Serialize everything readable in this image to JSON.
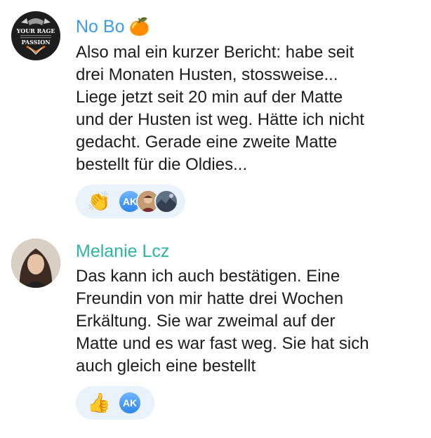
{
  "messages": [
    {
      "author": "No Bo",
      "author_color": "#3d9be9",
      "author_emoji": "🍊",
      "avatar_text": [
        "YOUR RAGE",
        "PASSION"
      ],
      "lines": [
        "Also mal ein kurzer Bericht: habe seit",
        "drei Monaten Husten, stossweise...",
        "Liege jetzt seit 20 min auf der Matte",
        "und der Husten ist weg. Hätte ich nicht",
        "gedacht. Gerade eine zweite Matte",
        "bestellt für die Oldies..."
      ],
      "reaction_emoji": "👏",
      "reactor_initials": "AK"
    },
    {
      "author": "Melanie Lcz",
      "author_color": "#2bb5a0",
      "lines": [
        "Das kann ich auch bestätigen. Eine",
        "Freundin von mir hatte drei Wochen",
        "Erkältung. Sie war zweimal auf der",
        "Matte und es war fast weg. Sie hat sich",
        "auch gleich eine bestellt"
      ],
      "reaction_emoji": "👍",
      "reactor_initials": "AK"
    }
  ]
}
